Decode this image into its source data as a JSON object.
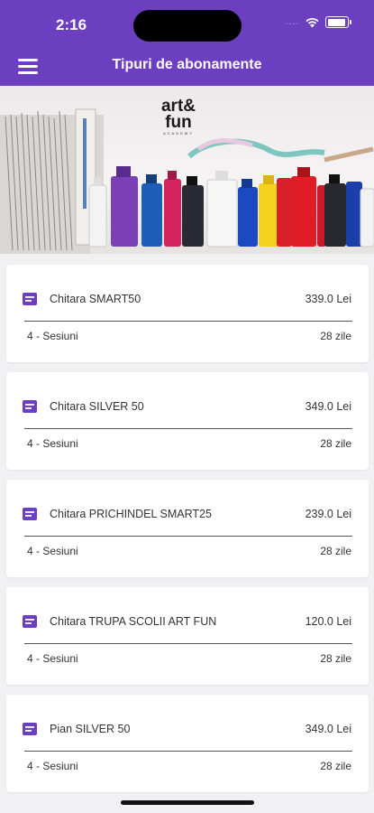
{
  "status_bar": {
    "time": "2:16",
    "signal_dots": "...."
  },
  "header": {
    "title": "Tipuri de abonamente"
  },
  "banner": {
    "logo_line1": "art&",
    "logo_line2": "fun",
    "logo_sub": "ACADEMY"
  },
  "subscriptions": [
    {
      "name": "Chitara SMART50",
      "price": "339.0 Lei",
      "sessions": "4 - Sesiuni",
      "days": "28 zile"
    },
    {
      "name": "Chitara SILVER 50",
      "price": "349.0 Lei",
      "sessions": "4 - Sesiuni",
      "days": "28 zile"
    },
    {
      "name": "Chitara PRICHINDEL SMART25",
      "price": "239.0 Lei",
      "sessions": "4 - Sesiuni",
      "days": "28 zile"
    },
    {
      "name": "Chitara TRUPA SCOLII ART FUN",
      "price": "120.0 Lei",
      "sessions": "4 - Sesiuni",
      "days": "28 zile"
    },
    {
      "name": "Pian SILVER 50",
      "price": "349.0 Lei",
      "sessions": "4 - Sesiuni",
      "days": "28 zile"
    }
  ],
  "colors": {
    "accent": "#6c3fc0",
    "background": "#f1f1f3",
    "card": "#ffffff"
  },
  "icons": {
    "menu": "hamburger-icon",
    "card": "card-list-icon",
    "wifi": "wifi-icon",
    "battery": "battery-icon"
  }
}
